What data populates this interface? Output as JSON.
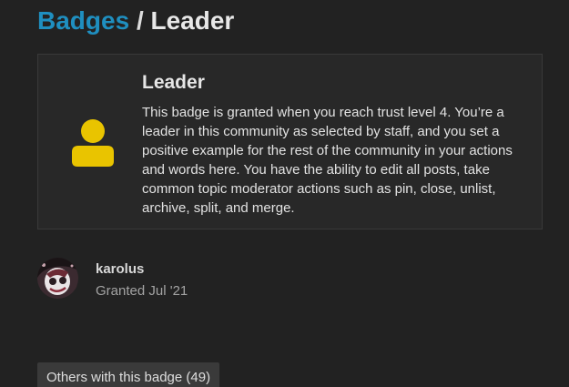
{
  "header": {
    "breadcrumb_link": "Badges",
    "separator": "/",
    "current": "Leader"
  },
  "badge": {
    "name": "Leader",
    "icon": "user-icon",
    "icon_color": "#e9c400",
    "description": "This badge is granted when you reach trust level 4. You’re a leader in this community as selected by staff, and you set a positive example for the rest of the community in your actions and words here. You have the ability to edit all posts, take common topic moderator actions such as pin, close, unlist, archive, split, and merge."
  },
  "grant": {
    "username": "karolus",
    "granted_text": "Granted Jul '21"
  },
  "others_button": {
    "label": "Others with this badge (49)"
  },
  "colors": {
    "background": "#222222",
    "link": "#1f8fc0",
    "card": "#282828"
  }
}
